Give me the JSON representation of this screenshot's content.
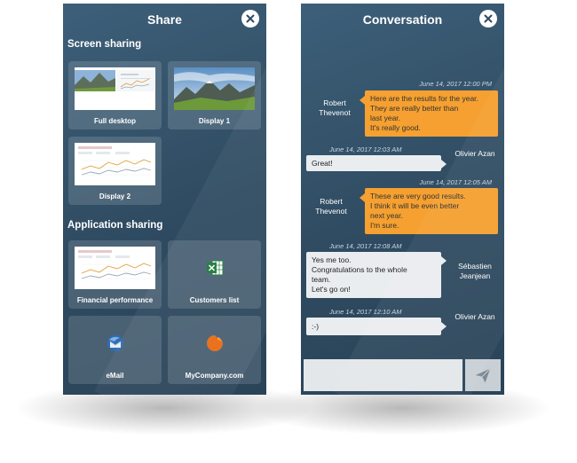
{
  "share": {
    "title": "Share",
    "screen_sharing_title": "Screen sharing",
    "application_sharing_title": "Application sharing",
    "screen_tiles": [
      {
        "label": "Full desktop"
      },
      {
        "label": "Display 1"
      },
      {
        "label": "Display 2",
        "thumb_title": "Financial Performance Review"
      }
    ],
    "app_tiles": [
      {
        "label": "Financial performance",
        "thumb_title": "Financial Performance Review"
      },
      {
        "label": "Customers list",
        "icon": "excel-icon"
      },
      {
        "label": "eMail",
        "icon": "thunderbird-icon"
      },
      {
        "label": "MyCompany.com",
        "icon": "firefox-icon"
      }
    ]
  },
  "chat": {
    "title": "Conversation",
    "messages": [
      {
        "time": "June 14, 2017 12:00 PM",
        "sender": "Robert Thevenot",
        "lines": [
          "Here are the results for the year.",
          "They are really better than",
          "last year.",
          "It's really good."
        ],
        "style": "orange"
      },
      {
        "time": "June 14, 2017 12:03 AM",
        "sender": "Olivier Azan",
        "lines": [
          "Great!"
        ],
        "style": "white"
      },
      {
        "time": "June 14, 2017 12:05 AM",
        "sender": "Robert Thevenot",
        "lines": [
          "These are very good results.",
          "I think it will be even better",
          "next year.",
          "I'm sure."
        ],
        "style": "orange"
      },
      {
        "time": "June 14, 2017 12:08 AM",
        "sender": "Sébastien Jeanjean",
        "lines": [
          "Yes me too.",
          "Congratulations to the whole",
          "team.",
          "Let's go on!"
        ],
        "style": "white"
      },
      {
        "time": "June 14, 2017 12:10 AM",
        "sender": "Olivier Azan",
        "lines": [
          ":-)"
        ],
        "style": "white"
      }
    ],
    "input_placeholder": ""
  },
  "colors": {
    "panel_bg": "#2f4b61",
    "orange_bubble": "#f5a030",
    "white_bubble": "#eaedf0"
  }
}
